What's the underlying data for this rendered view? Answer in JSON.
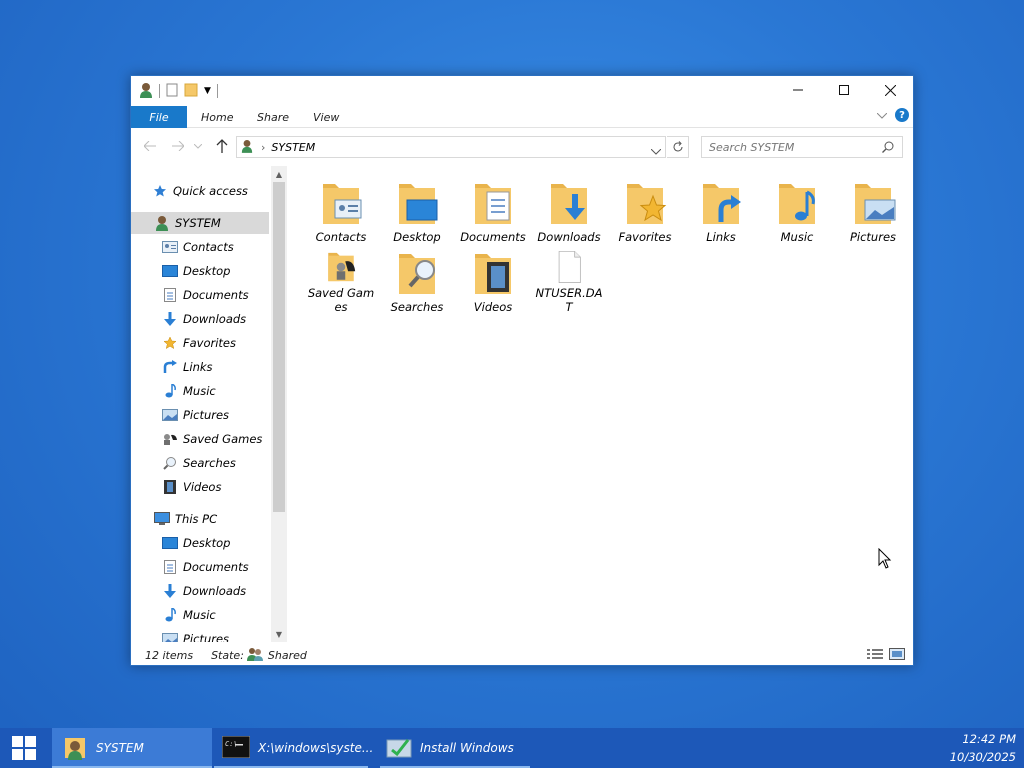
{
  "window": {
    "title_path": "SYSTEM",
    "ribbon_tabs": [
      "File",
      "Home",
      "Share",
      "View"
    ],
    "search_placeholder": "Search SYSTEM",
    "status_count": "12 items",
    "status_state_label": "State:",
    "status_state_value": "Shared"
  },
  "nav": {
    "quick_access": "Quick access",
    "user_folder": "SYSTEM",
    "user_items": [
      "Contacts",
      "Desktop",
      "Documents",
      "Downloads",
      "Favorites",
      "Links",
      "Music",
      "Pictures",
      "Saved Games",
      "Searches",
      "Videos"
    ],
    "this_pc": "This PC",
    "pc_items": [
      "Desktop",
      "Documents",
      "Downloads",
      "Music",
      "Pictures"
    ]
  },
  "files": [
    {
      "name": "Contacts",
      "icon": "contacts-folder-icon"
    },
    {
      "name": "Desktop",
      "icon": "desktop-folder-icon"
    },
    {
      "name": "Documents",
      "icon": "documents-folder-icon"
    },
    {
      "name": "Downloads",
      "icon": "downloads-folder-icon"
    },
    {
      "name": "Favorites",
      "icon": "favorites-folder-icon"
    },
    {
      "name": "Links",
      "icon": "links-folder-icon"
    },
    {
      "name": "Music",
      "icon": "music-folder-icon"
    },
    {
      "name": "Pictures",
      "icon": "pictures-folder-icon"
    },
    {
      "name": "Saved Games",
      "icon": "saved-games-folder-icon"
    },
    {
      "name": "Searches",
      "icon": "searches-folder-icon"
    },
    {
      "name": "Videos",
      "icon": "videos-folder-icon"
    },
    {
      "name": "NTUSER.DAT",
      "icon": "file-icon"
    }
  ],
  "taskbar": {
    "items": [
      "SYSTEM",
      "X:\\windows\\syste...",
      "Install Windows"
    ],
    "time": "12:42 PM",
    "date": "10/30/2025"
  },
  "colors": {
    "accent": "#1979ca",
    "taskbar": "#1d58b8",
    "folder": "#f5c869"
  }
}
